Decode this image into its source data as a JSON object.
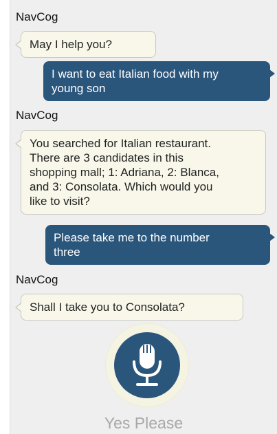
{
  "app": {
    "agent_name": "NavCog"
  },
  "conversation": [
    {
      "from": "agent",
      "sender": "NavCog",
      "lines": [
        "May I help you?"
      ]
    },
    {
      "from": "user",
      "lines": [
        "I want to eat Italian food with my",
        "young son"
      ]
    },
    {
      "from": "agent",
      "sender": "NavCog",
      "lines": [
        "You searched for Italian restaurant.",
        "There are 3 candidates in this",
        "shopping mall; 1: Adriana, 2: Blanca,",
        "and 3: Consolata. Which would you",
        "like to visit?"
      ]
    },
    {
      "from": "user",
      "lines": [
        "Please take me to the number",
        "three"
      ]
    },
    {
      "from": "agent",
      "sender": "NavCog",
      "lines": [
        "Shall I take you to Consolata?"
      ]
    }
  ],
  "voice_input": {
    "icon": "microphone-icon",
    "hint": "Yes Please"
  },
  "colors": {
    "user_bubble": "#2b567c",
    "agent_bubble": "#f8f7ea",
    "background": "#efefef",
    "mic_button": "#2b567c"
  }
}
